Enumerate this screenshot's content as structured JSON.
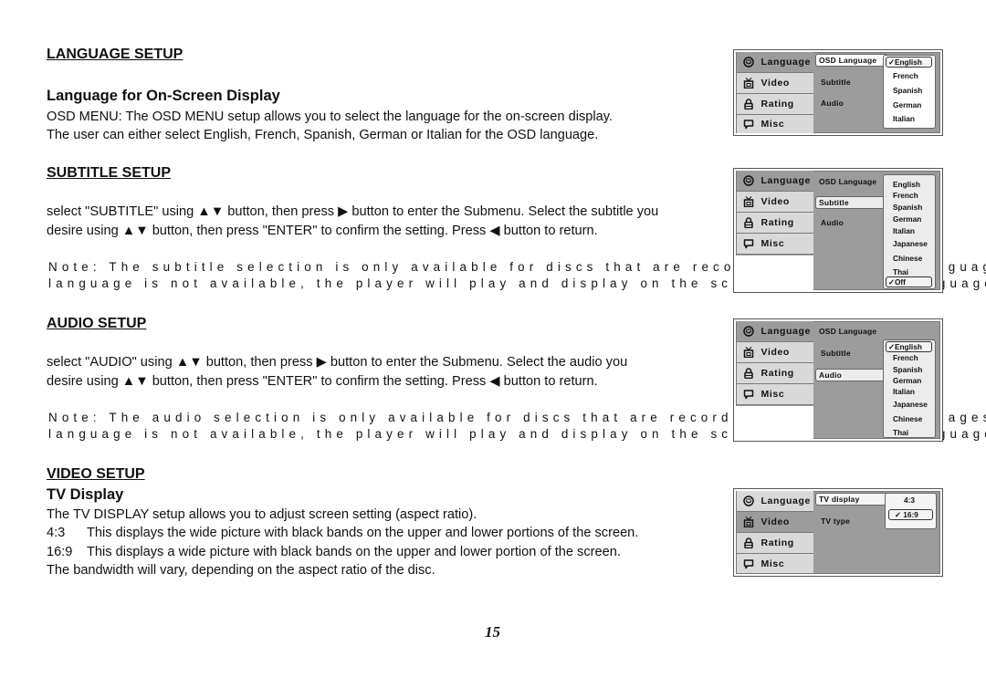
{
  "sections": {
    "language": {
      "heading": "LANGUAGE SETUP",
      "subheading": "Language for On-Screen Display",
      "lines": [
        "OSD MENU: The OSD MENU setup allows you to select the language for the on-screen display.",
        "The user can either select English, French, Spanish, German or Italian for the OSD language."
      ]
    },
    "subtitle": {
      "heading": "SUBTITLE SETUP",
      "lines": [
        "select \"SUBTITLE\" using ▲▼ button, then press ▶ button to enter the Submenu. Select the subtitle you",
        "desire using ▲▼ button, then press \"ENTER\" to confirm the setting. Press ◀ button to return."
      ],
      "note_lines": [
        "Note: The subtitle selection is only available for discs that are recorded in the above languages. If the",
        "language is not available, the player will play and display on the screen the original language contained"
      ]
    },
    "audio": {
      "heading": "AUDIO SETUP",
      "lines": [
        "select \"AUDIO\" using ▲▼ button, then press ▶ button to enter the Submenu. Select the audio you",
        "desire using ▲▼ button, then press \"ENTER\" to confirm the setting. Press ◀ button to return."
      ],
      "note_lines": [
        "Note: The audio selection is only available for discs that are recorded in the above languages. If the",
        "language is not available, the player will play and display on the screen the original language contained"
      ]
    },
    "video": {
      "heading": "VIDEO SETUP",
      "subheading": "TV Display",
      "lines": [
        "The TV DISPLAY setup allows you to adjust screen setting (aspect ratio).",
        "This displays the wide picture with black bands on the upper and lower portions of the screen.",
        "This displays a wide picture with black bands on the upper and lower portion of the screen.",
        "The bandwidth will vary, depending on the aspect ratio of the disc."
      ],
      "labels": [
        "4:3",
        "16:9"
      ]
    }
  },
  "osd": {
    "sidebar": [
      {
        "label": "Language",
        "icon": "smiley-icon"
      },
      {
        "label": "Video",
        "icon": "tv-icon"
      },
      {
        "label": "Rating",
        "icon": "lock-icon"
      },
      {
        "label": "Misc",
        "icon": "speech-bubble-icon"
      }
    ],
    "language_menu": [
      "OSD Language",
      "Subtitle",
      "Audio"
    ],
    "video_menu": [
      "TV display",
      "TV type"
    ],
    "panel1_options": [
      "English",
      "French",
      "Spanish",
      "German",
      "Italian"
    ],
    "panel1_selected": "✓English",
    "panel2_options": [
      "English",
      "French",
      "Spanish",
      "German",
      "Italian",
      "Japanese",
      "Chinese",
      "Thai"
    ],
    "panel2_selected": "✓Off",
    "panel3_options": [
      "French",
      "Spanish",
      "German",
      "Italian",
      "Japanese",
      "Chinese",
      "Thai"
    ],
    "panel3_selected": "✓English",
    "panel4_option": "4:3",
    "panel4_selected": "✓ 16:9"
  },
  "page_number": "15"
}
